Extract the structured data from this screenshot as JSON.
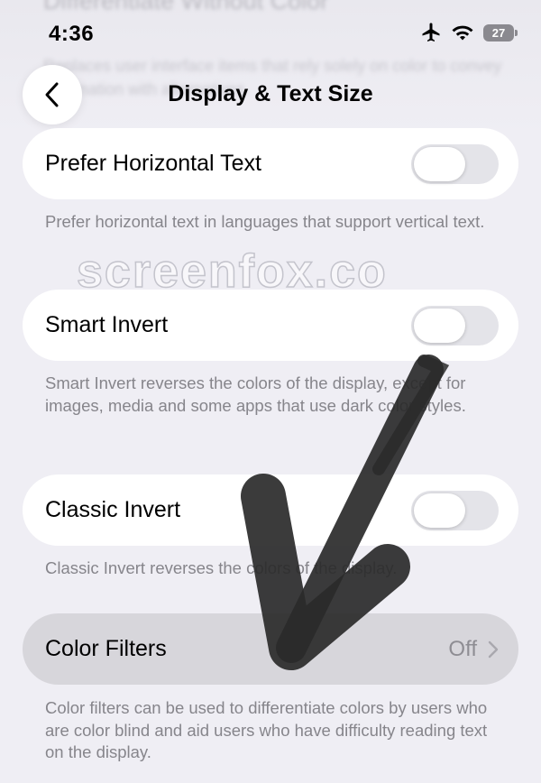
{
  "background_header": {
    "title": "Differentiate Without Color",
    "subtitle": "Replaces user interface items that rely solely on color to convey information with alternatives."
  },
  "status_bar": {
    "time": "4:36",
    "battery": "27"
  },
  "nav": {
    "title": "Display & Text Size"
  },
  "settings": [
    {
      "label": "Prefer Horizontal Text",
      "footer": "Prefer horizontal text in languages that support vertical text.",
      "toggle_on": false
    },
    {
      "label": "Smart Invert",
      "footer": "Smart Invert reverses the colors of the display, except for images, media and some apps that use dark color styles.",
      "toggle_on": false
    },
    {
      "label": "Classic Invert",
      "footer": "Classic Invert reverses the colors of the display.",
      "toggle_on": false
    },
    {
      "label": "Color Filters",
      "value": "Off",
      "footer": "Color filters can be used to differentiate colors by users who are color blind and aid users who have difficulty reading text on the display."
    }
  ],
  "watermark": "screenfox.co",
  "colors": {
    "background": "#efeef4",
    "cell": "#ffffff",
    "highlighted_cell": "#d7d6db",
    "secondary_text": "#86858b",
    "toggle_off": "#e4e4e9"
  }
}
